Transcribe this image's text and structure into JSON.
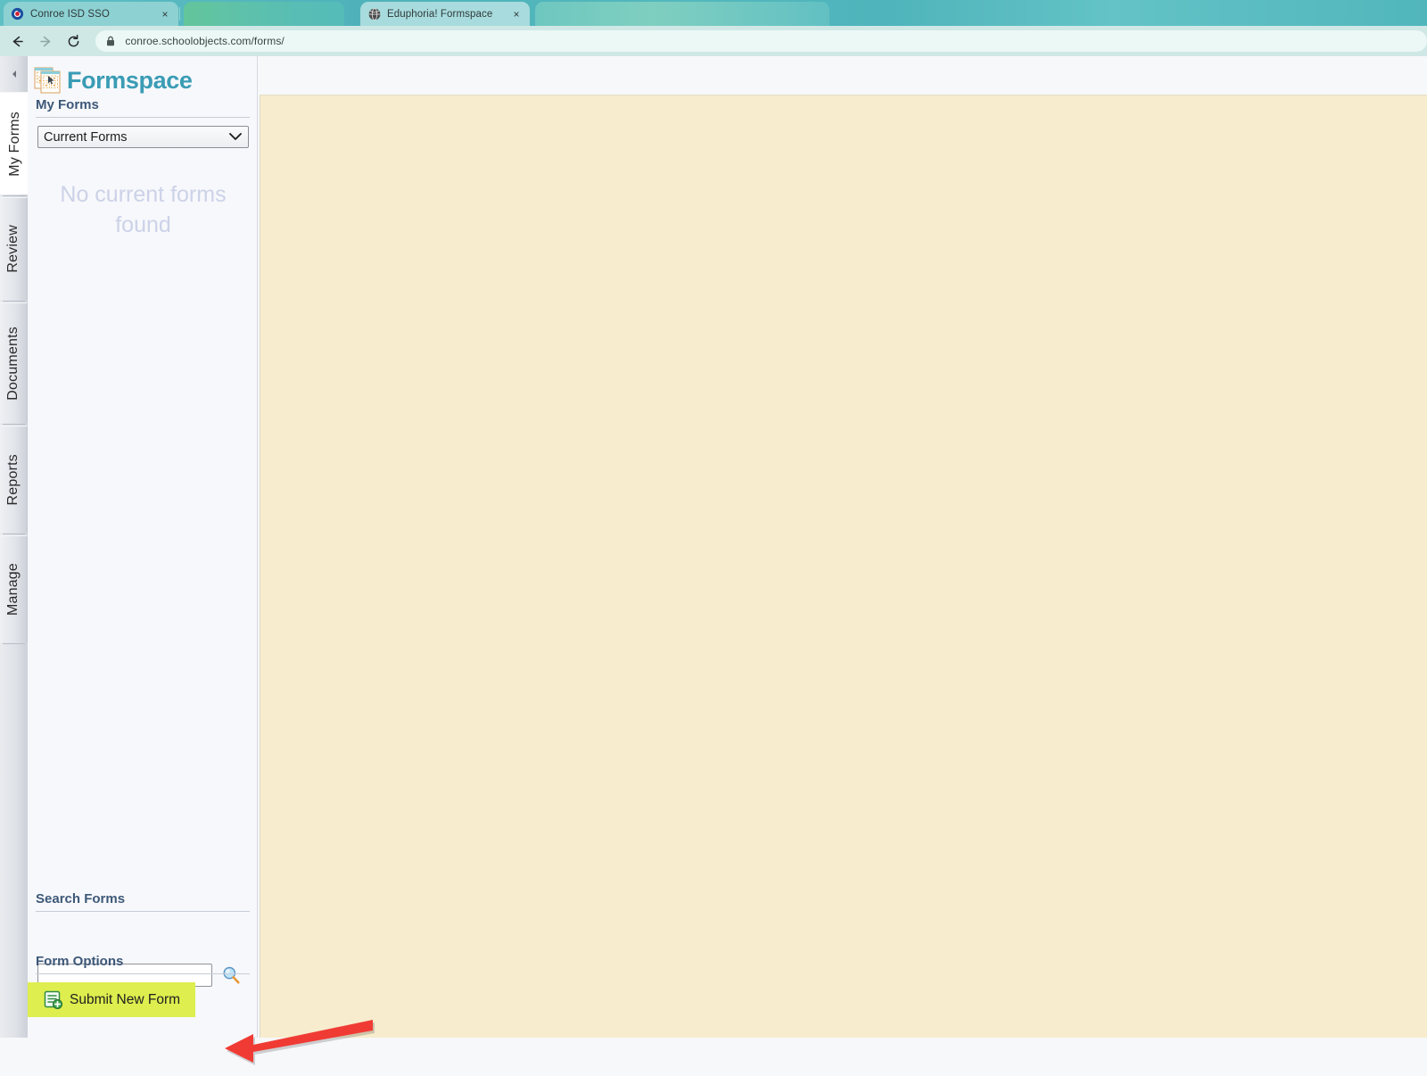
{
  "browser": {
    "tabs": [
      {
        "title": "Conroe ISD SSO",
        "favicon": "conroe-isd-logo-icon",
        "active": false,
        "close_label": "×"
      },
      {
        "title": "",
        "favicon": "",
        "active": false,
        "close_label": ""
      },
      {
        "title": "Eduphoria! Formspace",
        "favicon": "globe-icon",
        "active": true,
        "close_label": "×"
      },
      {
        "title": "",
        "favicon": "",
        "active": false,
        "close_label": ""
      }
    ],
    "toolbar": {
      "back_label": "Back",
      "forward_label": "Forward",
      "reload_label": "Reload",
      "lock_label": "Secure connection",
      "url": "conroe.schoolobjects.com/forms/"
    }
  },
  "app": {
    "brand": {
      "name": "Formspace",
      "logo_icon": "formspace-logo-icon"
    },
    "collapse_button": {
      "icon": "chevron-left-icon",
      "label": "Collapse panel"
    },
    "rail_tabs": [
      {
        "label": "My Forms",
        "active": true
      },
      {
        "label": "Review",
        "active": false
      },
      {
        "label": "Documents",
        "active": false
      },
      {
        "label": "Reports",
        "active": false
      },
      {
        "label": "Manage",
        "active": false
      }
    ],
    "my_forms": {
      "heading": "My Forms",
      "filter_value": "Current Forms",
      "filter_options": [
        "Current Forms"
      ],
      "caret_icon": "chevron-down-icon",
      "empty_message": "No current forms found"
    },
    "search": {
      "heading": "Search Forms",
      "value": "",
      "placeholder": "",
      "button_icon": "magnifier-icon",
      "button_label": "Search"
    },
    "form_options": {
      "heading": "Form Options",
      "submit_label": "Submit New Form",
      "submit_icon": "new-form-icon",
      "highlight_color": "#ddee4e"
    },
    "content_area": {
      "background_color": "#f7ecce"
    },
    "annotation": {
      "type": "arrow",
      "color": "#f03b34",
      "direction": "left",
      "points_to": "Submit New Form"
    }
  },
  "colors": {
    "brand_teal": "#3a9cb5",
    "heading_blue": "#3d5878",
    "empty_text": "#ccd2e8",
    "chrome_teal": "#53b8bd"
  }
}
